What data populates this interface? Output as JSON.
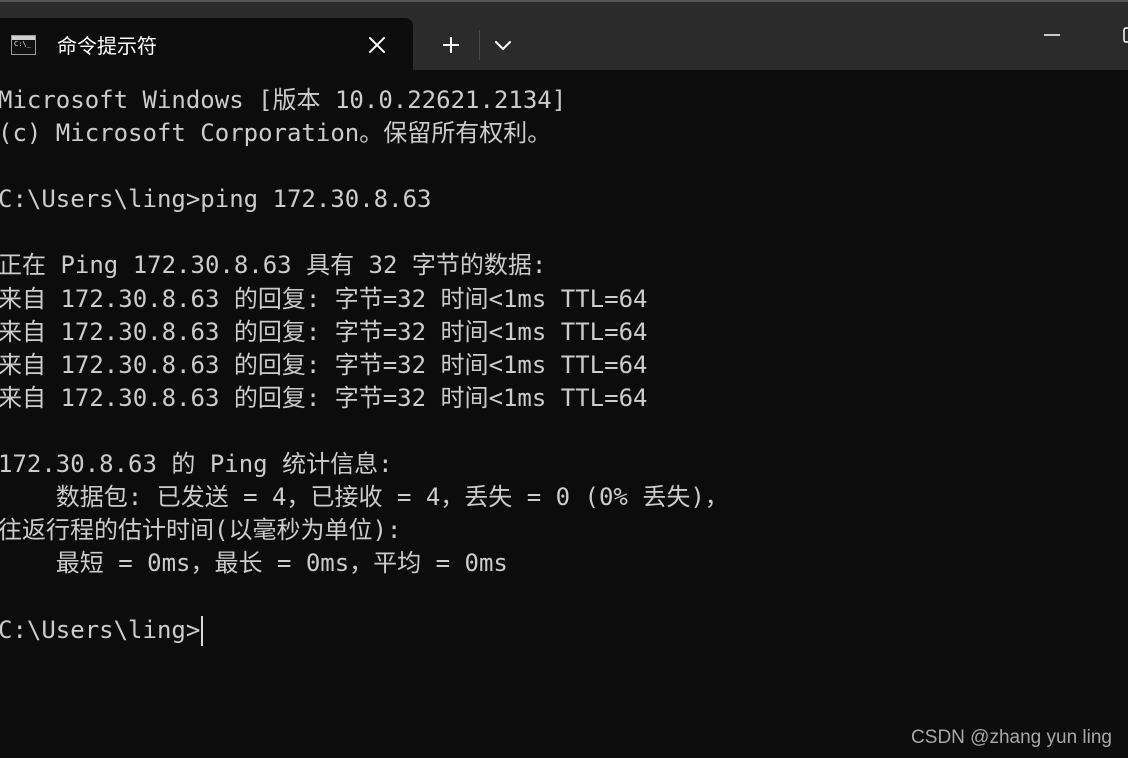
{
  "window": {
    "background": "#0c0c0c",
    "titlebar_color": "#2b2b2b",
    "text_color": "#cccccc"
  },
  "tab": {
    "icon_prompt": "C:\\_",
    "title": "命令提示符",
    "close_icon": "close-icon"
  },
  "titlebar": {
    "new_tab_icon": "plus-icon",
    "dropdown_icon": "chevron-down-icon",
    "minimize_icon": "minimize-icon",
    "maximize_icon": "maximize-icon"
  },
  "console": {
    "lines": [
      "Microsoft Windows [版本 10.0.22621.2134]",
      "(c) Microsoft Corporation。保留所有权利。",
      "",
      "C:\\Users\\ling>ping 172.30.8.63",
      "",
      "正在 Ping 172.30.8.63 具有 32 字节的数据:",
      "来自 172.30.8.63 的回复: 字节=32 时间<1ms TTL=64",
      "来自 172.30.8.63 的回复: 字节=32 时间<1ms TTL=64",
      "来自 172.30.8.63 的回复: 字节=32 时间<1ms TTL=64",
      "来自 172.30.8.63 的回复: 字节=32 时间<1ms TTL=64",
      "",
      "172.30.8.63 的 Ping 统计信息:",
      "    数据包: 已发送 = 4，已接收 = 4，丢失 = 0 (0% 丢失)，",
      "往返行程的估计时间(以毫秒为单位):",
      "    最短 = 0ms，最长 = 0ms，平均 = 0ms",
      "",
      "C:\\Users\\ling>"
    ]
  },
  "watermark": "CSDN @zhang yun ling"
}
